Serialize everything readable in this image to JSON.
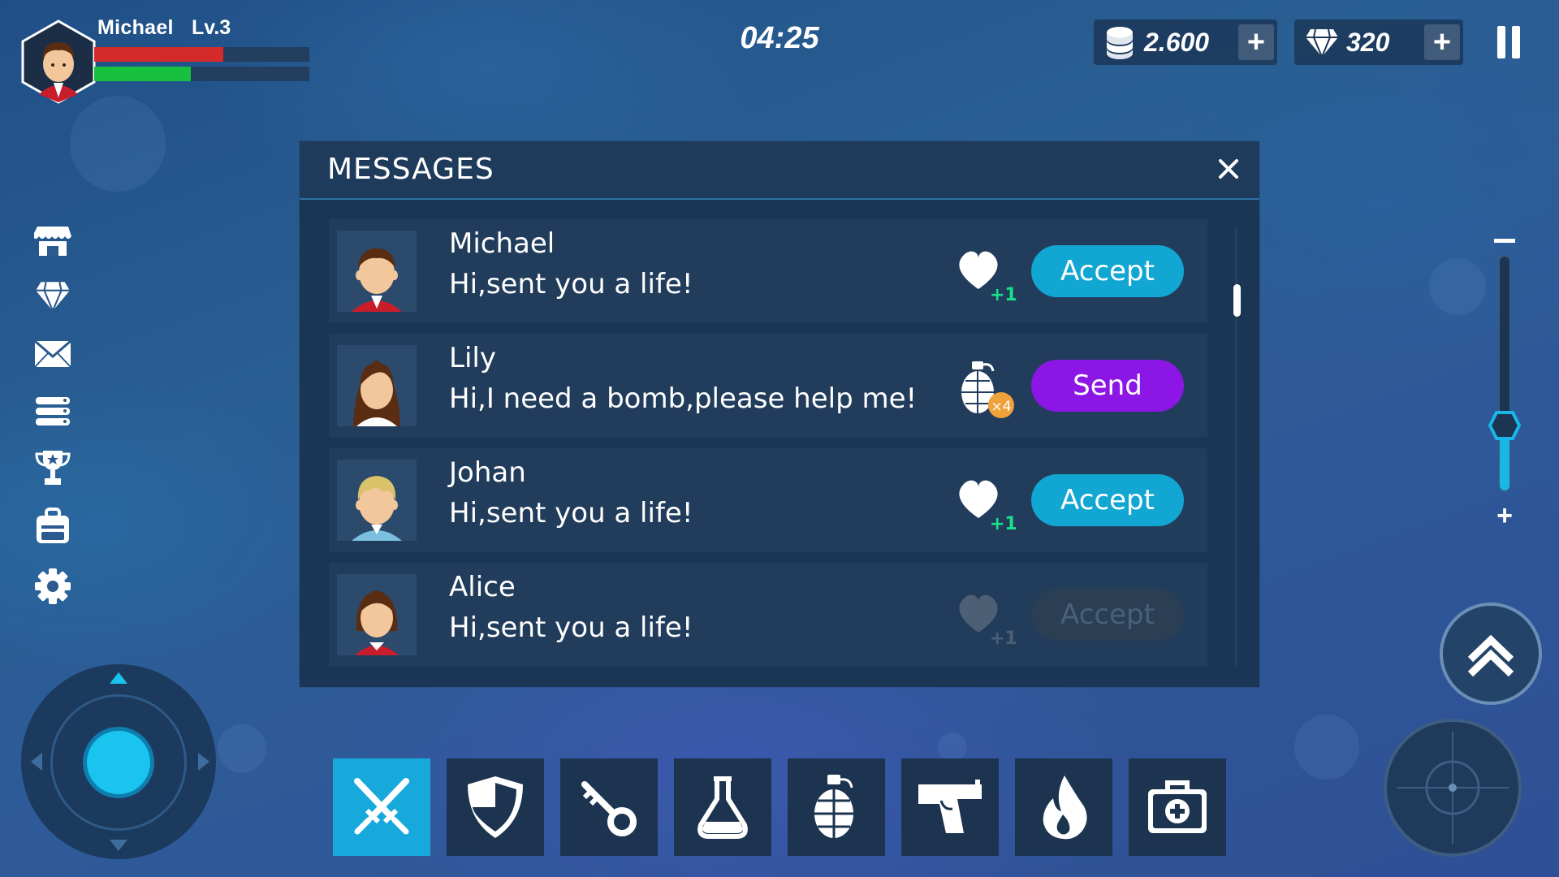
{
  "player": {
    "name": "Michael",
    "level": "Lv.3",
    "health": 0.6,
    "energy": 0.45
  },
  "hud": {
    "timer": "04:25",
    "coins": "2.600",
    "gems": "320",
    "add": "+"
  },
  "dialog": {
    "title": "MESSAGES",
    "close": "×",
    "messages": [
      {
        "name": "Michael",
        "text": "Hi,sent you a life!",
        "gift": "heart-icon",
        "gift_count": "+1",
        "action": "Accept",
        "state": "enabled"
      },
      {
        "name": "Lily",
        "text": "Hi,I need a bomb,please help me!",
        "gift": "grenade-icon",
        "gift_count": "×4",
        "action": "Send",
        "state": "enabled"
      },
      {
        "name": "Johan",
        "text": "Hi,sent you a life!",
        "gift": "heart-icon",
        "gift_count": "+1",
        "action": "Accept",
        "state": "enabled"
      },
      {
        "name": "Alice",
        "text": "Hi,sent you a life!",
        "gift": "heart-icon",
        "gift_count": "+1",
        "action": "Accept",
        "state": "disabled"
      }
    ]
  },
  "zoom": {
    "minus": "−",
    "plus": "+",
    "level": 0.25
  },
  "side_menu": [
    "shop-icon",
    "diamond-icon",
    "mail-icon",
    "list-icon",
    "trophy-icon",
    "backpack-icon",
    "settings-icon"
  ],
  "items": [
    "swords-icon",
    "shield-icon",
    "key-icon",
    "potion-icon",
    "grenade-icon",
    "pistol-icon",
    "fire-icon",
    "medkit-icon"
  ],
  "colors": {
    "accept": "#12a6d3",
    "send": "#8b16e6",
    "accent": "#17a9dc",
    "health": "#d42a2a",
    "energy": "#18c040",
    "plus_green": "#19e08a"
  }
}
